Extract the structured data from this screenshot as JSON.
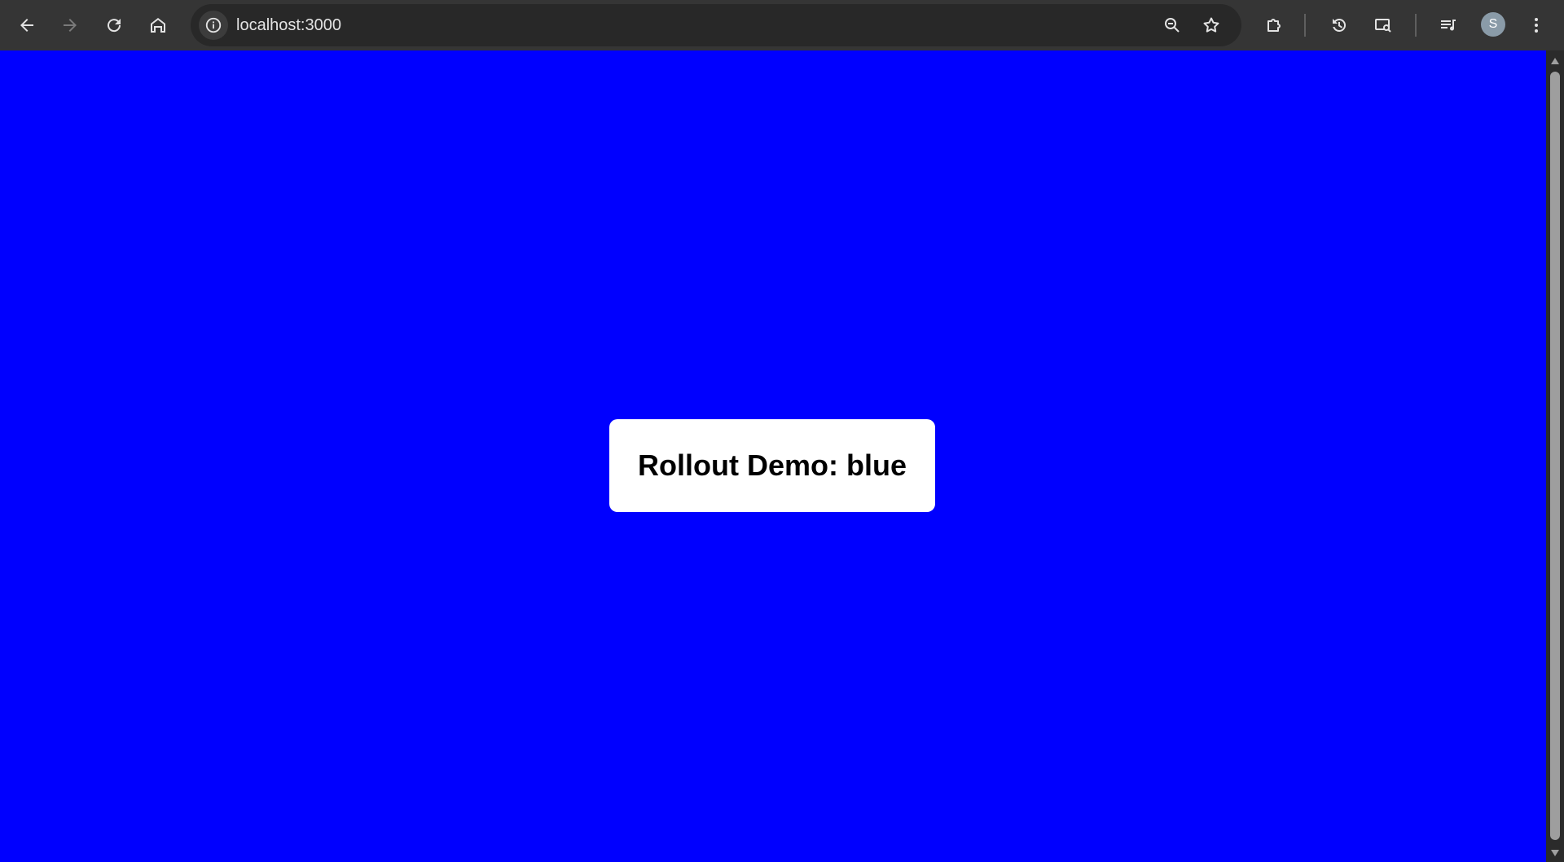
{
  "browser": {
    "url": "localhost:3000",
    "avatar_letter": "S",
    "icons": {
      "back": "back-arrow-icon",
      "forward": "forward-arrow-icon",
      "reload": "reload-icon",
      "home": "home-icon",
      "site_info": "info-icon",
      "zoom": "zoom-out-icon",
      "bookmark": "star-icon",
      "extensions": "puzzle-icon",
      "history": "history-icon",
      "lens": "search-page-icon",
      "media": "media-queue-icon",
      "menu": "kebab-menu-icon"
    }
  },
  "page": {
    "background_color": "#0000ff",
    "card_title": "Rollout Demo: blue"
  }
}
